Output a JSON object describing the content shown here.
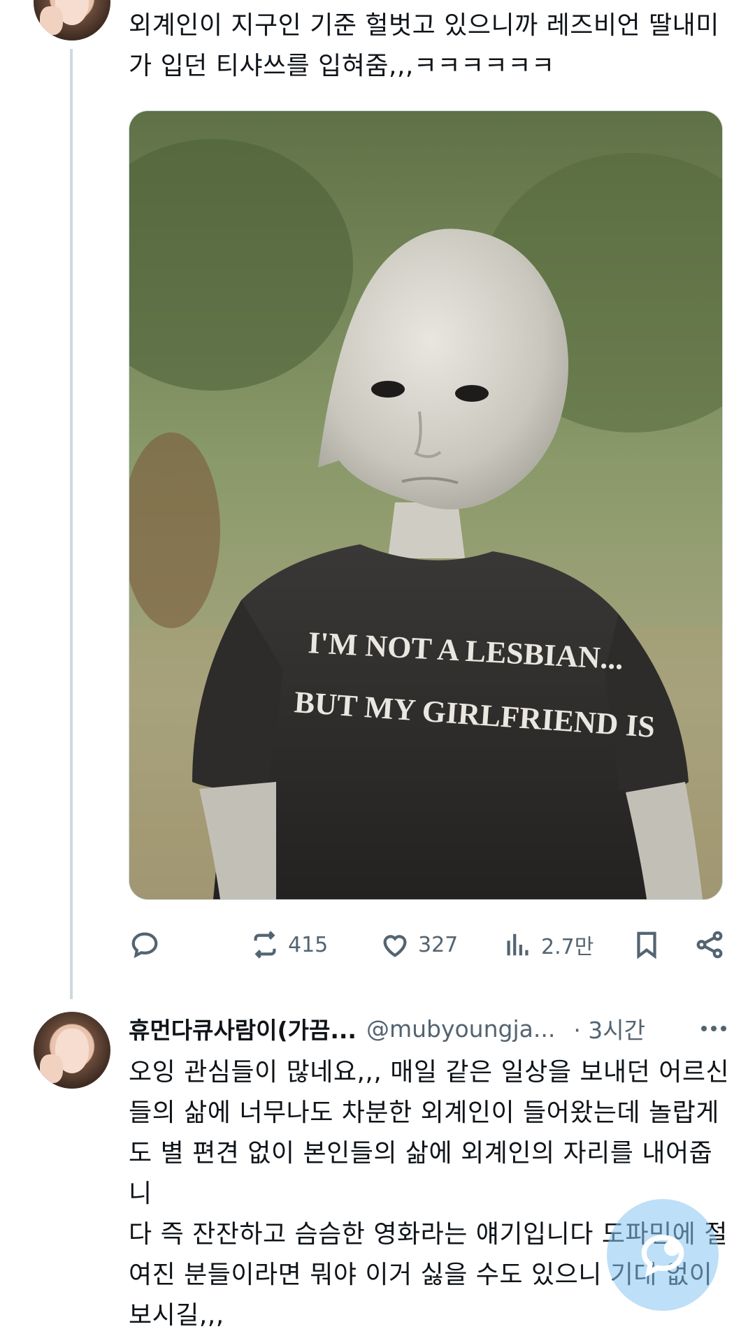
{
  "tweet": {
    "text": "외계인이 지구인 기준 헐벗고 있으니까 레즈비언 딸내미\n가 입던 티샤쓰를 입혀줌,,,ㅋㅋㅋㅋㅋㅋ",
    "media": {
      "shirt_line1": "I'M NOT A LESBIAN...",
      "shirt_line2": "BUT MY GIRLFRIEND IS"
    },
    "actions": {
      "reply_icon": "speech-bubble-icon",
      "retweet_icon": "retweet-icon",
      "retweet_count": "415",
      "like_icon": "heart-icon",
      "like_count": "327",
      "views_icon": "bar-chart-icon",
      "views_count": "2.7만",
      "bookmark_icon": "bookmark-icon",
      "share_icon": "share-icon"
    }
  },
  "reply": {
    "name": "휴먼다큐사람이(가끔...",
    "handle": "@mubyoungja...",
    "time": "· 3시간",
    "more_icon": "more-dots-icon",
    "text": "오잉 관심들이 많네요,,, 매일 같은 일상을 보내던 어르신\n들의 삶에 너무나도 차분한 외계인이 들어왔는데 놀랍게\n도 별 편견 없이 본인들의 삶에 외계인의 자리를 내어줍니\n다 즉 잔잔하고 슴슴한 영화라는 얘기입니다 도파민에 절\n여진 분들이라면 뭐야 이거 싫을 수도 있으니 기대 없이\n보시길,,,"
  },
  "fab": {
    "icon": "compose-reply-icon"
  },
  "colors": {
    "text_primary": "#0f1419",
    "text_secondary": "#536471",
    "thread_line": "#cfd9de",
    "fab": "#87c4f0"
  }
}
